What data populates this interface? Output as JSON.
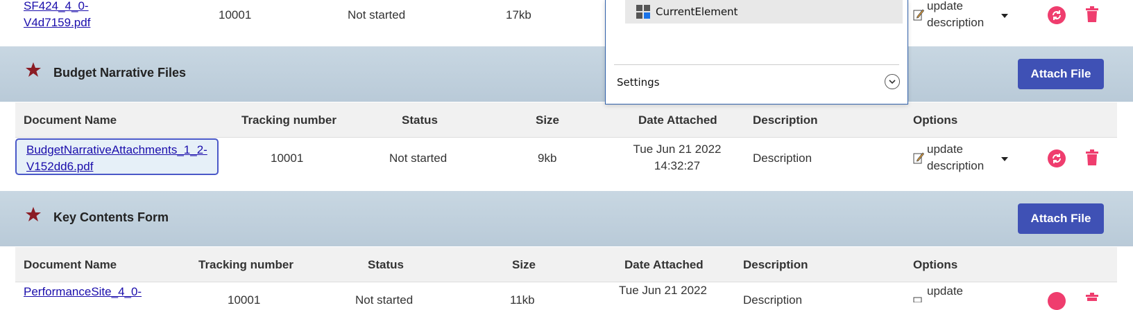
{
  "top_row": {
    "doc_name_line1": "SF424_4_0-",
    "doc_name_line2": "V4d7159.pdf",
    "tracking": "10001",
    "status": "Not started",
    "size": "17kb",
    "option_line1": "update",
    "option_line2": "description"
  },
  "popup": {
    "item_label": "CurrentElement",
    "settings_label": "Settings"
  },
  "budget_section": {
    "title": "Budget Narrative Files",
    "attach_label": "Attach File",
    "headers": {
      "doc_name": "Document Name",
      "tracking": "Tracking number",
      "status": "Status",
      "size": "Size",
      "date": "Date Attached",
      "description": "Description",
      "options": "Options"
    },
    "row": {
      "doc_name_line1": "BudgetNarrativeAttachments_1_2-",
      "doc_name_line2": "V152dd6.pdf",
      "tracking": "10001",
      "status": "Not started",
      "size": "9kb",
      "date_line1": "Tue Jun 21 2022",
      "date_line2": "14:32:27",
      "description": "Description",
      "option_line1": "update",
      "option_line2": "description"
    }
  },
  "key_section": {
    "title": "Key Contents Form",
    "attach_label": "Attach File",
    "headers": {
      "doc_name": "Document Name",
      "tracking": "Tracking number",
      "status": "Status",
      "size": "Size",
      "date": "Date Attached",
      "description": "Description",
      "options": "Options"
    },
    "row": {
      "doc_name_line1": "PerformanceSite_4_0-",
      "tracking": "10001",
      "status": "Not started",
      "size": "11kb",
      "date_line1": "Tue Jun 21 2022",
      "description": "Description",
      "option_line1": "update"
    }
  },
  "colors": {
    "accent": "#3f51b5",
    "star": "#8b1c24",
    "action_pink": "#ef3d6e",
    "band": "#c3d3df"
  }
}
